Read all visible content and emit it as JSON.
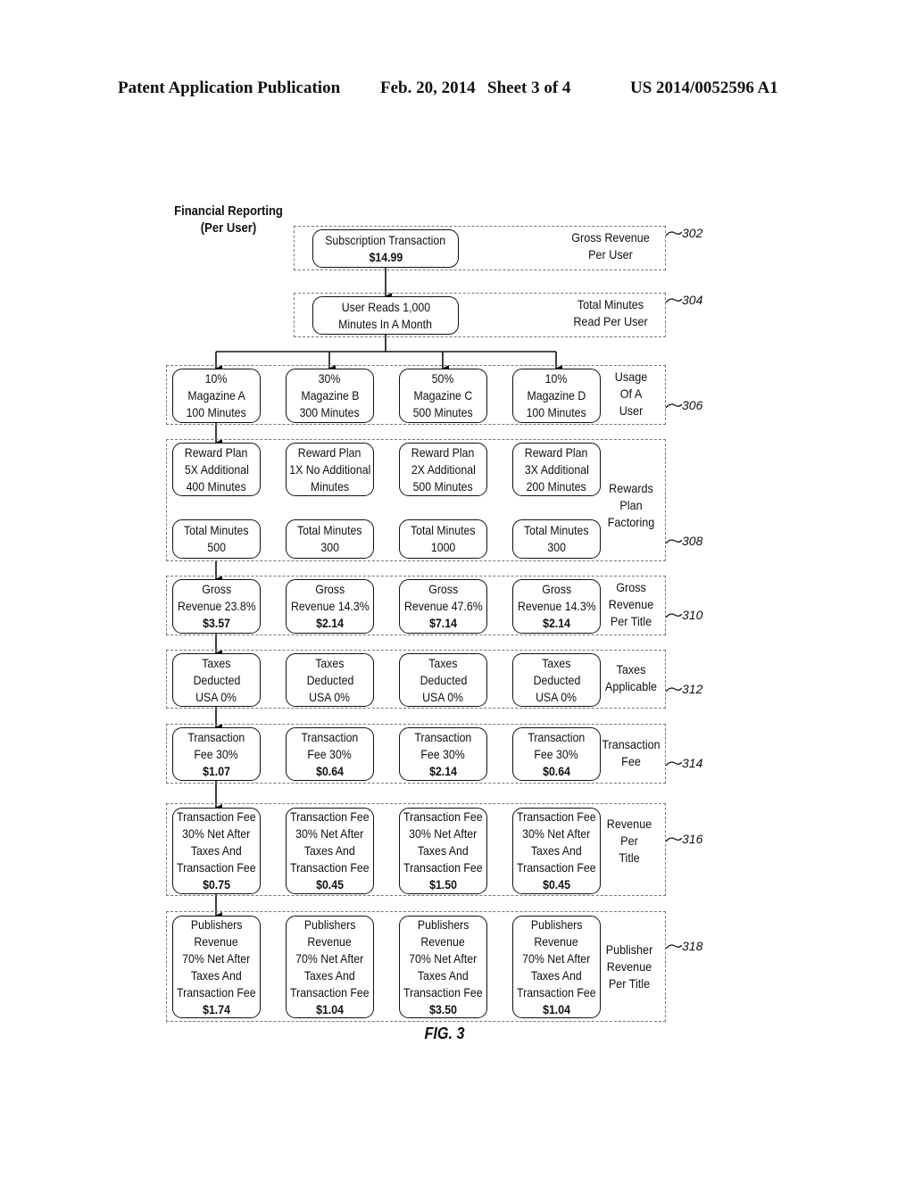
{
  "header": {
    "publication_label": "Patent Application Publication",
    "date": "Feb. 20, 2014",
    "sheet": "Sheet 3 of 4",
    "publication_number": "US 2014/0052596 A1"
  },
  "diagram": {
    "title_line1": "Financial Reporting",
    "title_line2": "(Per User)",
    "figure_label": "FIG. 3",
    "groups": [
      {
        "ref": "302",
        "label": [
          "Gross Revenue",
          "Per User"
        ],
        "boxes": [
          {
            "lines": [
              "Subscription Transaction"
            ],
            "bold": "$14.99"
          }
        ]
      },
      {
        "ref": "304",
        "label": [
          "Total Minutes",
          "Read Per User"
        ],
        "boxes": [
          {
            "lines": [
              "User Reads 1,000",
              "Minutes In A Month"
            ],
            "bold": ""
          }
        ]
      },
      {
        "ref": "306",
        "label": [
          "Usage",
          "Of A",
          "User"
        ],
        "boxes": [
          {
            "lines": [
              "10%",
              "Magazine A",
              "100 Minutes"
            ]
          },
          {
            "lines": [
              "30%",
              "Magazine B",
              "300 Minutes"
            ]
          },
          {
            "lines": [
              "50%",
              "Magazine C",
              "500 Minutes"
            ]
          },
          {
            "lines": [
              "10%",
              "Magazine D",
              "100 Minutes"
            ]
          }
        ]
      },
      {
        "ref": "308",
        "label": [
          "Rewards",
          "Plan",
          "Factoring"
        ],
        "boxes": [
          {
            "lines": [
              "Reward Plan",
              "5X Additional",
              "400 Minutes"
            ]
          },
          {
            "lines": [
              "Reward Plan",
              "1X No Additional",
              "Minutes"
            ]
          },
          {
            "lines": [
              "Reward Plan",
              "2X Additional",
              "500 Minutes"
            ]
          },
          {
            "lines": [
              "Reward Plan",
              "3X Additional",
              "200 Minutes"
            ]
          }
        ],
        "boxes2": [
          {
            "lines": [
              "Total Minutes",
              "500"
            ]
          },
          {
            "lines": [
              "Total Minutes",
              "300"
            ]
          },
          {
            "lines": [
              "Total Minutes",
              "1000"
            ]
          },
          {
            "lines": [
              "Total Minutes",
              "300"
            ]
          }
        ]
      },
      {
        "ref": "310",
        "label": [
          "Gross",
          "Revenue",
          "Per Title"
        ],
        "boxes": [
          {
            "lines": [
              "Gross",
              "Revenue 23.8%"
            ],
            "bold": "$3.57"
          },
          {
            "lines": [
              "Gross",
              "Revenue 14.3%"
            ],
            "bold": "$2.14"
          },
          {
            "lines": [
              "Gross",
              "Revenue 47.6%"
            ],
            "bold": "$7.14"
          },
          {
            "lines": [
              "Gross",
              "Revenue 14.3%"
            ],
            "bold": "$2.14"
          }
        ]
      },
      {
        "ref": "312",
        "label": [
          "Taxes",
          "Applicable"
        ],
        "boxes": [
          {
            "lines": [
              "Taxes",
              "Deducted",
              "USA 0%"
            ]
          },
          {
            "lines": [
              "Taxes",
              "Deducted",
              "USA 0%"
            ]
          },
          {
            "lines": [
              "Taxes",
              "Deducted",
              "USA 0%"
            ]
          },
          {
            "lines": [
              "Taxes",
              "Deducted",
              "USA 0%"
            ]
          }
        ]
      },
      {
        "ref": "314",
        "label": [
          "Transaction",
          "Fee"
        ],
        "boxes": [
          {
            "lines": [
              "Transaction",
              "Fee 30%"
            ],
            "bold": "$1.07"
          },
          {
            "lines": [
              "Transaction",
              "Fee 30%"
            ],
            "bold": "$0.64"
          },
          {
            "lines": [
              "Transaction",
              "Fee 30%"
            ],
            "bold": "$2.14"
          },
          {
            "lines": [
              "Transaction",
              "Fee 30%"
            ],
            "bold": "$0.64"
          }
        ]
      },
      {
        "ref": "316",
        "label": [
          "Revenue",
          "Per",
          "Title"
        ],
        "boxes": [
          {
            "lines": [
              "Transaction Fee",
              "30% Net After",
              "Taxes And",
              "Transaction Fee"
            ],
            "bold": "$0.75"
          },
          {
            "lines": [
              "Transaction Fee",
              "30% Net After",
              "Taxes And",
              "Transaction Fee"
            ],
            "bold": "$0.45"
          },
          {
            "lines": [
              "Transaction Fee",
              "30% Net After",
              "Taxes And",
              "Transaction Fee"
            ],
            "bold": "$1.50"
          },
          {
            "lines": [
              "Transaction Fee",
              "30% Net After",
              "Taxes And",
              "Transaction Fee"
            ],
            "bold": "$0.45"
          }
        ]
      },
      {
        "ref": "318",
        "label": [
          "Publisher",
          "Revenue",
          "Per Title"
        ],
        "boxes": [
          {
            "lines": [
              "Publishers",
              "Revenue",
              "70% Net After",
              "Taxes And",
              "Transaction Fee"
            ],
            "bold": "$1.74"
          },
          {
            "lines": [
              "Publishers",
              "Revenue",
              "70% Net After",
              "Taxes And",
              "Transaction Fee"
            ],
            "bold": "$1.04"
          },
          {
            "lines": [
              "Publishers",
              "Revenue",
              "70% Net After",
              "Taxes And",
              "Transaction Fee"
            ],
            "bold": "$3.50"
          },
          {
            "lines": [
              "Publishers",
              "Revenue",
              "70% Net After",
              "Taxes And",
              "Transaction Fee"
            ],
            "bold": "$1.04"
          }
        ]
      }
    ]
  }
}
